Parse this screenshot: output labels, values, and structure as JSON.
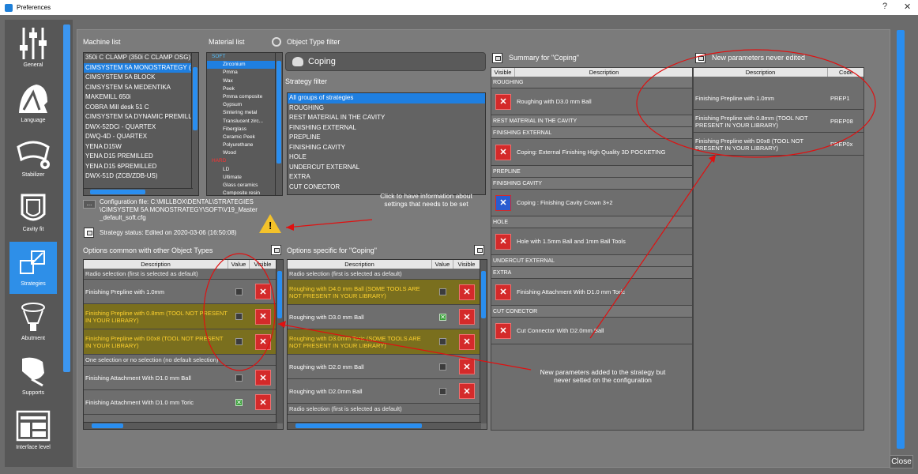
{
  "window": {
    "title": "Preferences",
    "help": "?",
    "close": "✕"
  },
  "sidebar": {
    "items": [
      {
        "label": "General"
      },
      {
        "label": "Language"
      },
      {
        "label": "Stabilizer"
      },
      {
        "label": "Cavity fit"
      },
      {
        "label": "Strategies"
      },
      {
        "label": "Abutment"
      },
      {
        "label": "Supports"
      },
      {
        "label": "Interface level"
      }
    ]
  },
  "machine_list": {
    "label": "Machine list",
    "items": [
      "350i C CLAMP (350i C CLAMP OSG)",
      "CIMSYSTEM 5A MONOSTRATEGY (OS",
      "CIMSYSTEM 5A BLOCK",
      "CIMSYSTEM 5A MEDENTIKA",
      "MAKEMILL 650i",
      "COBRA Mill desk 51 C",
      "CIMSYSTEM 5A DYNAMIC PREMILLE",
      "DWX-52DCi - QUARTEX",
      "DWQ-4D - QUARTEX",
      "YENA D15W",
      "YENA D15 PREMILLED",
      "YENA D15 6PREMILLED",
      "DWX-51D (ZCB/ZDB-US)"
    ]
  },
  "material_list": {
    "label": "Material list",
    "soft_label": "SOFT",
    "soft": [
      "Zirconium",
      "Pmma",
      "Wax",
      "Peek",
      "Pmma composite",
      "Gypsum",
      "Sintering metal",
      "Translucent zirc...",
      "Fiberglass",
      "Ceramic Peek",
      "Polyurethane",
      "Wood"
    ],
    "hard_label": "HARD",
    "hard": [
      "LD",
      "Ultimate",
      "Glass ceramics",
      "Composite resin"
    ]
  },
  "object_type": {
    "label": "Object Type filter",
    "value": "Coping"
  },
  "strategy_filter": {
    "label": "Strategy filter",
    "items": [
      "All groups of strategies",
      "ROUGHING",
      "REST MATERIAL IN THE CAVITY",
      "FINISHING EXTERNAL",
      "PREPLINE",
      "FINISHING CAVITY",
      "HOLE",
      "UNDERCUT EXTERNAL",
      "EXTRA",
      "CUT CONECTOR"
    ]
  },
  "config": {
    "btn": "...",
    "file": "Configuration file: C:\\MILLBOX\\DENTAL\\STRATEGIES\\CIMSYSTEM 5A MONOSTRATEGY\\SOFT\\V19_Master_default_soft.cfg",
    "status": "Strategy status: Edited on 2020-03-06 (16:50:08)"
  },
  "common": {
    "label": "Options common with other Object Types",
    "headers": [
      "Description",
      "Value",
      "Visible"
    ],
    "rows": [
      {
        "text": "Radio selection (first is selected as default)",
        "kind": "grp"
      },
      {
        "text": "Finishing Prepline with 1.0mm",
        "kind": "row"
      },
      {
        "text": "Finishing Prepline with 0.8mm (TOOL NOT PRESENT IN YOUR LIBRARY)",
        "kind": "hl"
      },
      {
        "text": "Finishing Prepline with D0x8 (TOOL NOT PRESENT IN YOUR LIBRARY)",
        "kind": "hl"
      },
      {
        "text": "One selection or no selection (no default selection)",
        "kind": "grp"
      },
      {
        "text": "Finishing Attachment With D1.0 mm Ball",
        "kind": "row"
      },
      {
        "text": "Finishing Attachment With D1.0 mm Toric",
        "kind": "row"
      }
    ]
  },
  "specific": {
    "label": "Options specific for \"Coping\"",
    "headers": [
      "Description",
      "Value",
      "Visible"
    ],
    "rows": [
      {
        "text": "Radio selection (first is selected as default)",
        "kind": "grp"
      },
      {
        "text": "Roughing with D4.0 mm Ball (SOME TOOLS ARE NOT PRESENT IN YOUR LIBRARY)",
        "kind": "hl"
      },
      {
        "text": "Roughing with D3.0 mm Ball",
        "kind": "row"
      },
      {
        "text": "Roughing with D3.0mm Toric (SOME TOOLS ARE NOT PRESENT IN YOUR LIBRARY)",
        "kind": "hl"
      },
      {
        "text": "Roughing with D2.0 mm Ball",
        "kind": "row"
      },
      {
        "text": "Roughing with D2.0mm Ball",
        "kind": "row"
      },
      {
        "text": "Radio selection (first is selected as default)",
        "kind": "grp"
      }
    ]
  },
  "summary": {
    "label": "Summary for \"Coping\"",
    "headers": [
      "Visible",
      "Description"
    ],
    "groups": [
      {
        "name": "ROUGHING",
        "item": "Roughing with D3.0 mm Ball"
      },
      {
        "name": "REST MATERIAL IN THE CAVITY",
        "item": ""
      },
      {
        "name": "FINISHING EXTERNAL",
        "item": "Coping: External Finishing High Quality 3D POCKETING"
      },
      {
        "name": "PREPLINE",
        "item": ""
      },
      {
        "name": "FINISHING CAVITY",
        "item": "Coping : Finishing Cavity Crown 3+2"
      },
      {
        "name": "HOLE",
        "item": "Hole with 1.5mm Ball and 1mm Ball Tools"
      },
      {
        "name": "UNDERCUT EXTERNAL",
        "item": ""
      },
      {
        "name": "EXTRA",
        "item": "Finishing Attachment With D1.0 mm Toric"
      },
      {
        "name": "CUT CONECTOR",
        "item": "Cut Connector With D2.0mm Ball"
      }
    ]
  },
  "never_edited": {
    "label": "New parameters never edited",
    "headers": [
      "Description",
      "Code"
    ],
    "rows": [
      {
        "desc": "Finishing Prepline with 1.0mm",
        "code": "PREP1"
      },
      {
        "desc": "Finishing Prepline with 0.8mm (TOOL NOT PRESENT IN YOUR LIBRARY)",
        "code": "PREP08"
      },
      {
        "desc": "Finishing Prepline with D0x8 (TOOL NOT PRESENT IN YOUR LIBRARY)",
        "code": "PREP0x"
      }
    ]
  },
  "annotations": {
    "info": "Click to have information about settings that needs to be set",
    "new_params": "New parameters added to the strategy but never setted on the configuration"
  },
  "close_label": "Close",
  "colors": {
    "accent": "#2e8fe8",
    "warn_text": "#ffd22e",
    "red": "#d42a2a",
    "annotation": "#e01010"
  }
}
